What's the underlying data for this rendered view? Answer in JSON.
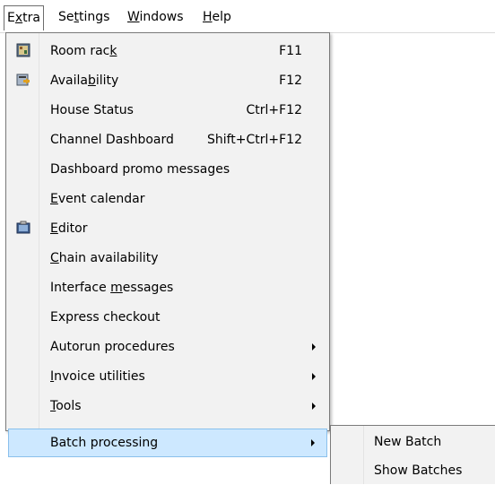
{
  "menubar": {
    "items": [
      {
        "pre": "E",
        "key": "x",
        "post": "tra"
      },
      {
        "pre": "Se",
        "key": "t",
        "post": "tings"
      },
      {
        "pre": "",
        "key": "W",
        "post": "indows"
      },
      {
        "pre": "",
        "key": "H",
        "post": "elp"
      }
    ]
  },
  "menu": {
    "items": [
      {
        "pre": "Room rac",
        "key": "k",
        "post": "",
        "shortcut": "F11",
        "icon": "room-rack-icon"
      },
      {
        "pre": "Availa",
        "key": "b",
        "post": "ility",
        "shortcut": "F12",
        "icon": "availability-icon"
      },
      {
        "pre": "House Status",
        "key": "",
        "post": "",
        "shortcut": "Ctrl+F12"
      },
      {
        "pre": "Channel Dashboard",
        "key": "",
        "post": "",
        "shortcut": "Shift+Ctrl+F12"
      },
      {
        "pre": "Dashboard promo messages",
        "key": "",
        "post": ""
      },
      {
        "pre": "",
        "key": "E",
        "post": "vent calendar"
      },
      {
        "pre": "",
        "key": "E",
        "post": "ditor",
        "icon": "editor-icon"
      },
      {
        "pre": "",
        "key": "C",
        "post": "hain availability"
      },
      {
        "pre": "Interface ",
        "key": "m",
        "post": "essages"
      },
      {
        "pre": "Express checkout",
        "key": "",
        "post": ""
      },
      {
        "pre": "Autorun procedures",
        "key": "",
        "post": "",
        "submenu": true
      },
      {
        "pre": "",
        "key": "I",
        "post": "nvoice utilities",
        "submenu": true
      },
      {
        "pre": "",
        "key": "T",
        "post": "ools",
        "submenu": true
      },
      {
        "pre": "Batch processing",
        "key": "",
        "post": "",
        "submenu": true,
        "highlighted": true
      }
    ]
  },
  "submenu": {
    "items": [
      {
        "label": "New Batch"
      },
      {
        "label": "Show Batches"
      }
    ]
  },
  "colors": {
    "menu_bg": "#f2f2f2",
    "highlight_bg": "#cde8ff",
    "highlight_border": "#8ac0ec"
  }
}
